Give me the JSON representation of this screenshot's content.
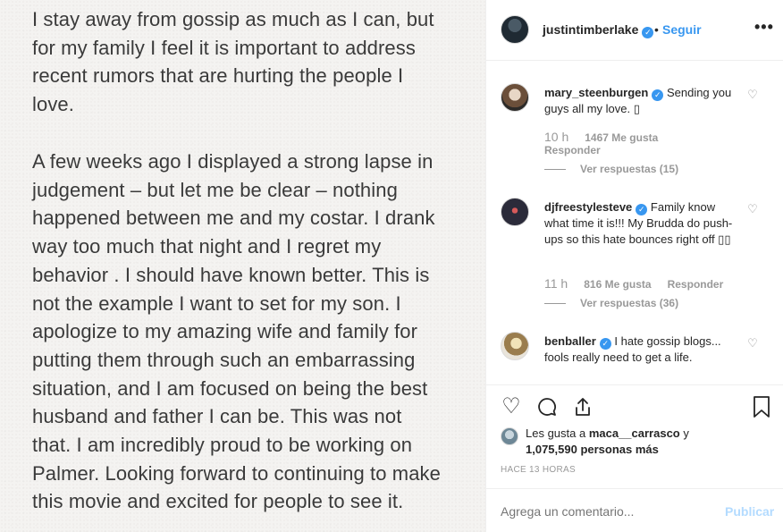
{
  "post_image": {
    "paragraph1": "I stay away from gossip as much as I can, but\nfor my family I feel it is important to address\nrecent rumors that are hurting the people I\nlove.",
    "paragraph2": "A few weeks ago I displayed a strong lapse in\njudgement – but let me be clear – nothing\nhappened between me and my costar. I drank\nway too much that night and I regret my\nbehavior . I should have known better. This is\nnot the example I want to set for my son. I\napologize to my amazing wife and family for\nputting them through such an embarrassing\nsituation, and I am focused on being the best\nhusband and father I can be. This was not\nthat. I am incredibly proud to be working on\nPalmer. Looking forward to continuing to make\nthis movie and excited for people to see it."
  },
  "header": {
    "username": "justintimberlake",
    "separator": "•",
    "follow_label": "Seguir",
    "more_icon": "more-horizontal-icon"
  },
  "comments": [
    {
      "username": "mary_steenburgen",
      "text": "Sending you guys all my love. ▯",
      "time": "10 h",
      "likes": "1467 Me gusta",
      "reply": "Responder",
      "view_replies": "Ver respuestas (15)"
    },
    {
      "username": "djfreestylesteve",
      "text": "Family know what time it is!!! My Brudda do push-ups so this hate bounces right off ▯▯",
      "time": "11 h",
      "likes": "816 Me gusta",
      "reply": "Responder",
      "view_replies": "Ver respuestas (36)"
    },
    {
      "username": "benballer",
      "text": "I hate gossip blogs... fools really need to get a life."
    }
  ],
  "actions": {
    "icons": [
      "heart-icon",
      "comment-icon",
      "share-icon",
      "bookmark-icon"
    ]
  },
  "likes": {
    "prefix": "Les gusta a ",
    "user": "maca__carrasco",
    "mid": " y",
    "count": "1,075,590 personas más"
  },
  "timestamp": "HACE 13 HORAS",
  "comment_box": {
    "placeholder": "Agrega un comentario...",
    "publish_label": "Publicar"
  },
  "colors": {
    "accent": "#3897f0",
    "publish_disabled": "#b3dbff",
    "muted": "#999999",
    "text": "#262626"
  }
}
